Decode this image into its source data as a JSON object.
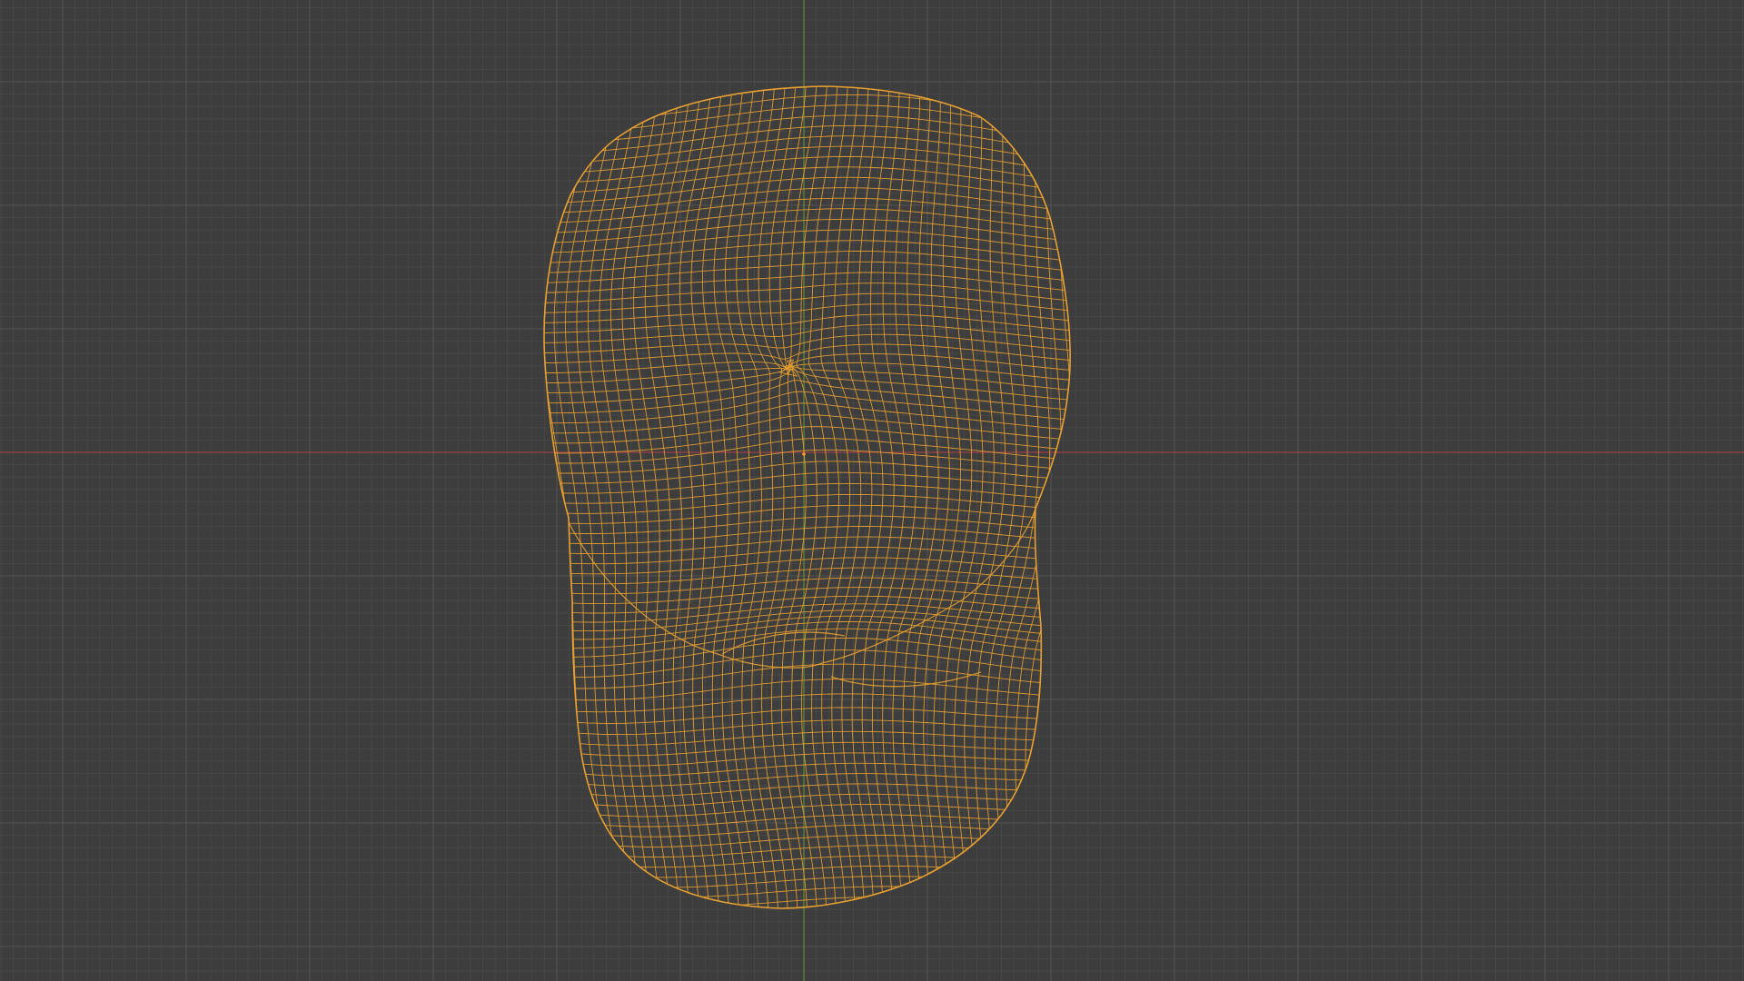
{
  "viewport": {
    "background_color": "#3d3d3d",
    "grid_minor_color": "#484848",
    "grid_major_color": "#525252",
    "x_axis_color": "#9a4048",
    "y_axis_color": "#5e8a40",
    "object": {
      "display": "wireframe",
      "selected": true,
      "wire_color": "#e8a030"
    },
    "origin_marker_color": "#ff9a30"
  }
}
